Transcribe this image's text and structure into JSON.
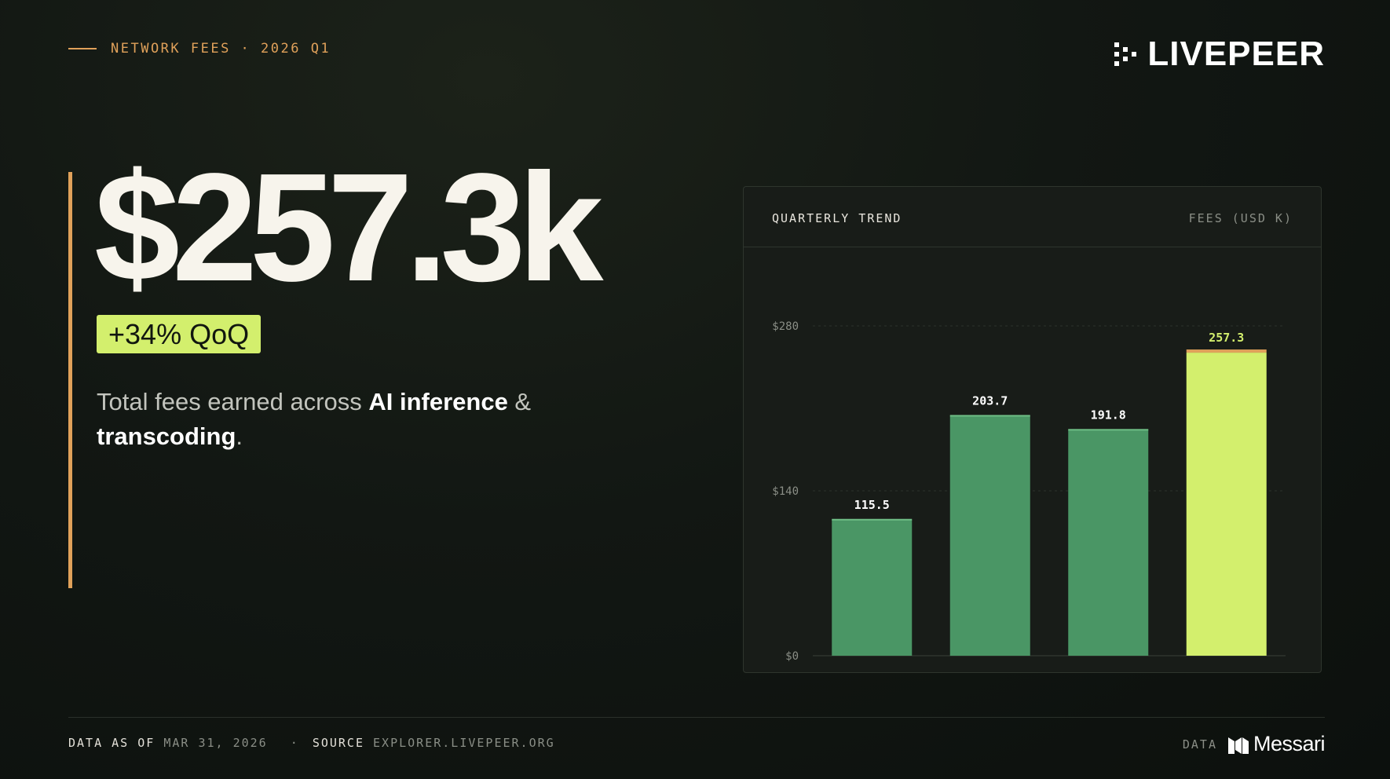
{
  "header": {
    "eyebrow": "NETWORK FEES · 2026 Q1",
    "brand": "LIVEPEER"
  },
  "hero": {
    "value": "$257.3k",
    "badge": "+34% QoQ",
    "desc_before": "Total fees earned across ",
    "desc_strong_1": "AI inference",
    "desc_mid": " & ",
    "desc_strong_2": "transcoding",
    "desc_after": "."
  },
  "card": {
    "title": "QUARTERLY TREND",
    "unit": "FEES (USD K)"
  },
  "chart_data": {
    "type": "bar",
    "values": [
      115.5,
      203.7,
      191.8,
      257.3
    ],
    "value_labels": [
      "115.5",
      "203.7",
      "191.8",
      "257.3"
    ],
    "highlight_index": 3,
    "y_ticks": [
      {
        "value": 0,
        "label": "$0"
      },
      {
        "value": 140,
        "label": "$140"
      },
      {
        "value": 280,
        "label": "$280"
      }
    ],
    "ylim": [
      0,
      280
    ],
    "grid": true,
    "colors": {
      "bar": "#4a9665",
      "bar_top": "#6fbf86",
      "highlight": "#d3ef6d",
      "highlight_top": "#e0a15a",
      "label": "#ffffff",
      "highlight_label": "#d3ef6d",
      "tick": "#8a8e86",
      "grid": "#2c322b"
    }
  },
  "footer": {
    "asof_key": "DATA AS OF",
    "asof_value": "MAR 31, 2026",
    "source_key": "SOURCE",
    "source_value": "EXPLORER.LIVEPEER.ORG",
    "data_key": "DATA",
    "partner": "Messari"
  },
  "colors": {
    "accent": "#e0a15a",
    "lime": "#d3ef6d",
    "green": "#4a9665",
    "background": "#0e120f"
  }
}
